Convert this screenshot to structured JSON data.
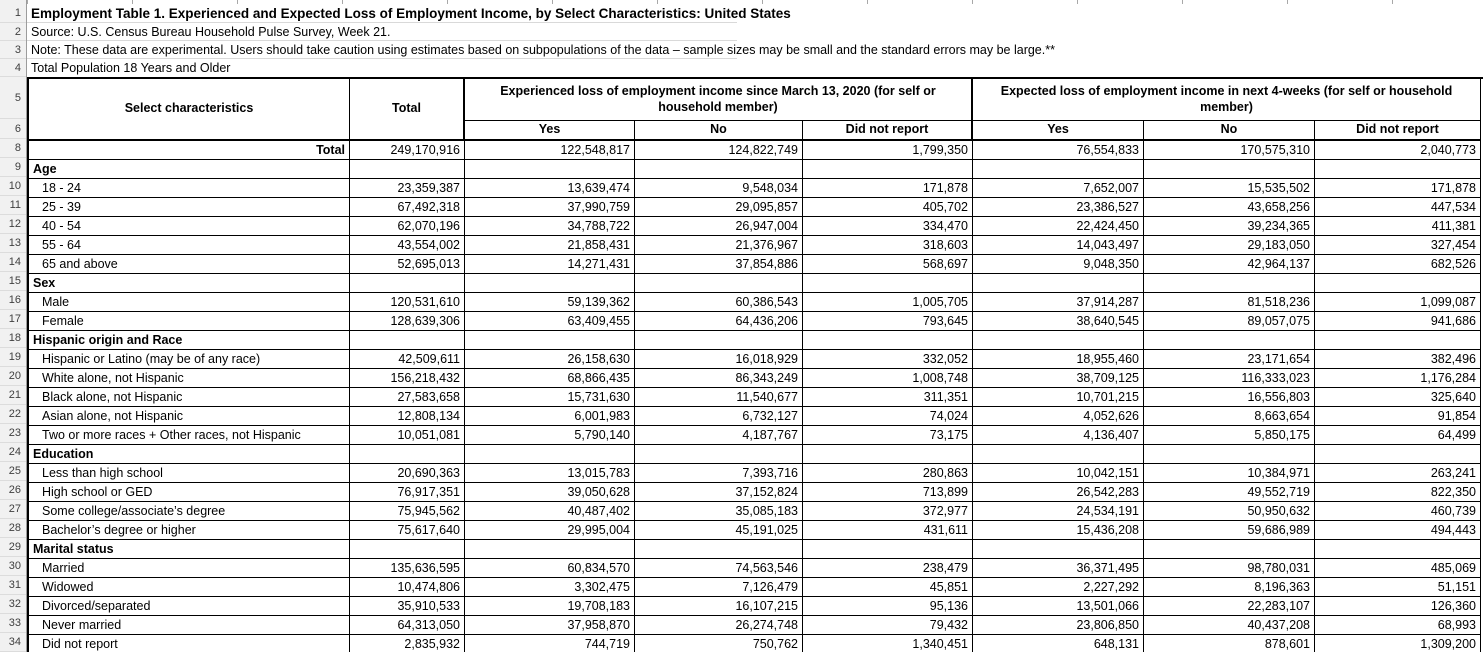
{
  "meta": {
    "title": "Employment Table 1. Experienced and Expected Loss of Employment Income, by Select Characteristics: United States",
    "source": "Source: U.S. Census Bureau Household Pulse Survey, Week 21.",
    "note": "Note: These data are experimental. Users should take caution using estimates based on subpopulations of the data – sample sizes may be small and the standard errors may be large.**",
    "population": "Total Population 18 Years and Older"
  },
  "gutter": {
    "numbers": [
      "1",
      "2",
      "3",
      "4",
      "5",
      "6",
      "8",
      "9",
      "10",
      "11",
      "12",
      "13",
      "14",
      "15",
      "16",
      "17",
      "18",
      "19",
      "20",
      "21",
      "22",
      "23",
      "24",
      "25",
      "26",
      "27",
      "28",
      "29",
      "30",
      "31",
      "32",
      "33",
      "34"
    ]
  },
  "table": {
    "col_label": "Select characteristics",
    "col_total": "Total",
    "group1": "Experienced loss of employment income since March 13, 2020 (for self or household member)",
    "group2": "Expected loss of employment income in next 4-weeks (for self or household member)",
    "sub_headers": [
      "Yes",
      "No",
      "Did not report",
      "Yes",
      "No",
      "Did not report"
    ],
    "rows": [
      {
        "type": "total",
        "label": "Total",
        "values": [
          "249,170,916",
          "122,548,817",
          "124,822,749",
          "1,799,350",
          "76,554,833",
          "170,575,310",
          "2,040,773"
        ]
      },
      {
        "type": "section",
        "label": "Age",
        "values": []
      },
      {
        "type": "data",
        "label": "18 - 24",
        "values": [
          "23,359,387",
          "13,639,474",
          "9,548,034",
          "171,878",
          "7,652,007",
          "15,535,502",
          "171,878"
        ]
      },
      {
        "type": "data",
        "label": "25 - 39",
        "values": [
          "67,492,318",
          "37,990,759",
          "29,095,857",
          "405,702",
          "23,386,527",
          "43,658,256",
          "447,534"
        ]
      },
      {
        "type": "data",
        "label": "40 - 54",
        "values": [
          "62,070,196",
          "34,788,722",
          "26,947,004",
          "334,470",
          "22,424,450",
          "39,234,365",
          "411,381"
        ]
      },
      {
        "type": "data",
        "label": "55 - 64",
        "values": [
          "43,554,002",
          "21,858,431",
          "21,376,967",
          "318,603",
          "14,043,497",
          "29,183,050",
          "327,454"
        ]
      },
      {
        "type": "data",
        "label": "65 and above",
        "values": [
          "52,695,013",
          "14,271,431",
          "37,854,886",
          "568,697",
          "9,048,350",
          "42,964,137",
          "682,526"
        ]
      },
      {
        "type": "section",
        "label": "Sex",
        "values": []
      },
      {
        "type": "data",
        "label": "Male",
        "values": [
          "120,531,610",
          "59,139,362",
          "60,386,543",
          "1,005,705",
          "37,914,287",
          "81,518,236",
          "1,099,087"
        ]
      },
      {
        "type": "data",
        "label": "Female",
        "values": [
          "128,639,306",
          "63,409,455",
          "64,436,206",
          "793,645",
          "38,640,545",
          "89,057,075",
          "941,686"
        ]
      },
      {
        "type": "section",
        "label": "Hispanic origin and Race",
        "values": []
      },
      {
        "type": "data",
        "label": "Hispanic or Latino (may be of any race)",
        "values": [
          "42,509,611",
          "26,158,630",
          "16,018,929",
          "332,052",
          "18,955,460",
          "23,171,654",
          "382,496"
        ]
      },
      {
        "type": "data",
        "label": "White alone, not Hispanic",
        "values": [
          "156,218,432",
          "68,866,435",
          "86,343,249",
          "1,008,748",
          "38,709,125",
          "116,333,023",
          "1,176,284"
        ]
      },
      {
        "type": "data",
        "label": "Black alone, not Hispanic",
        "values": [
          "27,583,658",
          "15,731,630",
          "11,540,677",
          "311,351",
          "10,701,215",
          "16,556,803",
          "325,640"
        ]
      },
      {
        "type": "data",
        "label": "Asian alone, not Hispanic",
        "values": [
          "12,808,134",
          "6,001,983",
          "6,732,127",
          "74,024",
          "4,052,626",
          "8,663,654",
          "91,854"
        ]
      },
      {
        "type": "data",
        "label": "Two or more races + Other races, not Hispanic",
        "values": [
          "10,051,081",
          "5,790,140",
          "4,187,767",
          "73,175",
          "4,136,407",
          "5,850,175",
          "64,499"
        ]
      },
      {
        "type": "section",
        "label": "Education",
        "values": []
      },
      {
        "type": "data",
        "label": "Less than high school",
        "values": [
          "20,690,363",
          "13,015,783",
          "7,393,716",
          "280,863",
          "10,042,151",
          "10,384,971",
          "263,241"
        ]
      },
      {
        "type": "data",
        "label": "High school or GED",
        "values": [
          "76,917,351",
          "39,050,628",
          "37,152,824",
          "713,899",
          "26,542,283",
          "49,552,719",
          "822,350"
        ]
      },
      {
        "type": "data",
        "label": "Some college/associate’s degree",
        "values": [
          "75,945,562",
          "40,487,402",
          "35,085,183",
          "372,977",
          "24,534,191",
          "50,950,632",
          "460,739"
        ]
      },
      {
        "type": "data",
        "label": "Bachelor’s degree or higher",
        "values": [
          "75,617,640",
          "29,995,004",
          "45,191,025",
          "431,611",
          "15,436,208",
          "59,686,989",
          "494,443"
        ]
      },
      {
        "type": "section",
        "label": "Marital status",
        "values": []
      },
      {
        "type": "data",
        "label": "Married",
        "values": [
          "135,636,595",
          "60,834,570",
          "74,563,546",
          "238,479",
          "36,371,495",
          "98,780,031",
          "485,069"
        ]
      },
      {
        "type": "data",
        "label": "Widowed",
        "values": [
          "10,474,806",
          "3,302,475",
          "7,126,479",
          "45,851",
          "2,227,292",
          "8,196,363",
          "51,151"
        ]
      },
      {
        "type": "data",
        "label": "Divorced/separated",
        "values": [
          "35,910,533",
          "19,708,183",
          "16,107,215",
          "95,136",
          "13,501,066",
          "22,283,107",
          "126,360"
        ]
      },
      {
        "type": "data",
        "label": "Never married",
        "values": [
          "64,313,050",
          "37,958,870",
          "26,274,748",
          "79,432",
          "23,806,850",
          "40,437,208",
          "68,993"
        ]
      },
      {
        "type": "data",
        "label": "Did not report",
        "values": [
          "2,835,932",
          "744,719",
          "750,762",
          "1,340,451",
          "648,131",
          "878,601",
          "1,309,200"
        ]
      }
    ]
  }
}
